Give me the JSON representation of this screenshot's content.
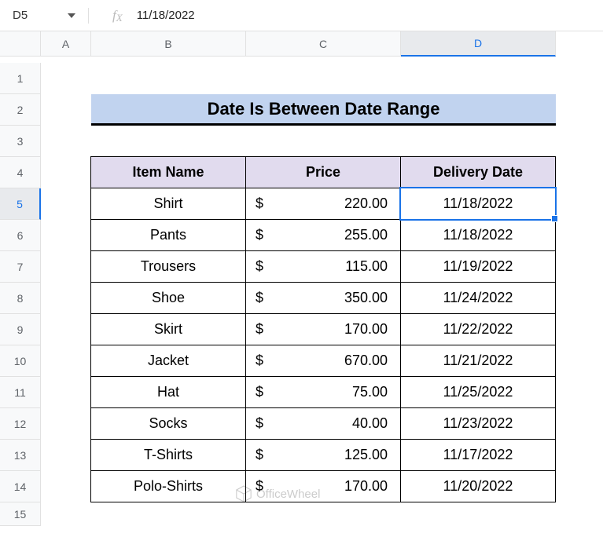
{
  "name_box": "D5",
  "formula_value": "11/18/2022",
  "columns": [
    "A",
    "B",
    "C",
    "D"
  ],
  "rows": [
    "1",
    "2",
    "3",
    "4",
    "5",
    "6",
    "7",
    "8",
    "9",
    "10",
    "11",
    "12",
    "13",
    "14",
    "15"
  ],
  "title": "Date Is Between Date Range",
  "headers": {
    "item": "Item Name",
    "price": "Price",
    "date": "Delivery Date"
  },
  "currency": "$",
  "data": [
    {
      "item": "Shirt",
      "price": "220.00",
      "date": "11/18/2022"
    },
    {
      "item": "Pants",
      "price": "255.00",
      "date": "11/18/2022"
    },
    {
      "item": "Trousers",
      "price": "115.00",
      "date": "11/19/2022"
    },
    {
      "item": "Shoe",
      "price": "350.00",
      "date": "11/24/2022"
    },
    {
      "item": "Skirt",
      "price": "170.00",
      "date": "11/22/2022"
    },
    {
      "item": "Jacket",
      "price": "670.00",
      "date": "11/21/2022"
    },
    {
      "item": "Hat",
      "price": "75.00",
      "date": "11/25/2022"
    },
    {
      "item": "Socks",
      "price": "40.00",
      "date": "11/23/2022"
    },
    {
      "item": "T-Shirts",
      "price": "125.00",
      "date": "11/17/2022"
    },
    {
      "item": "Polo-Shirts",
      "price": "170.00",
      "date": "11/20/2022"
    }
  ],
  "watermark": "OfficeWheel",
  "selected_cell": "D5"
}
